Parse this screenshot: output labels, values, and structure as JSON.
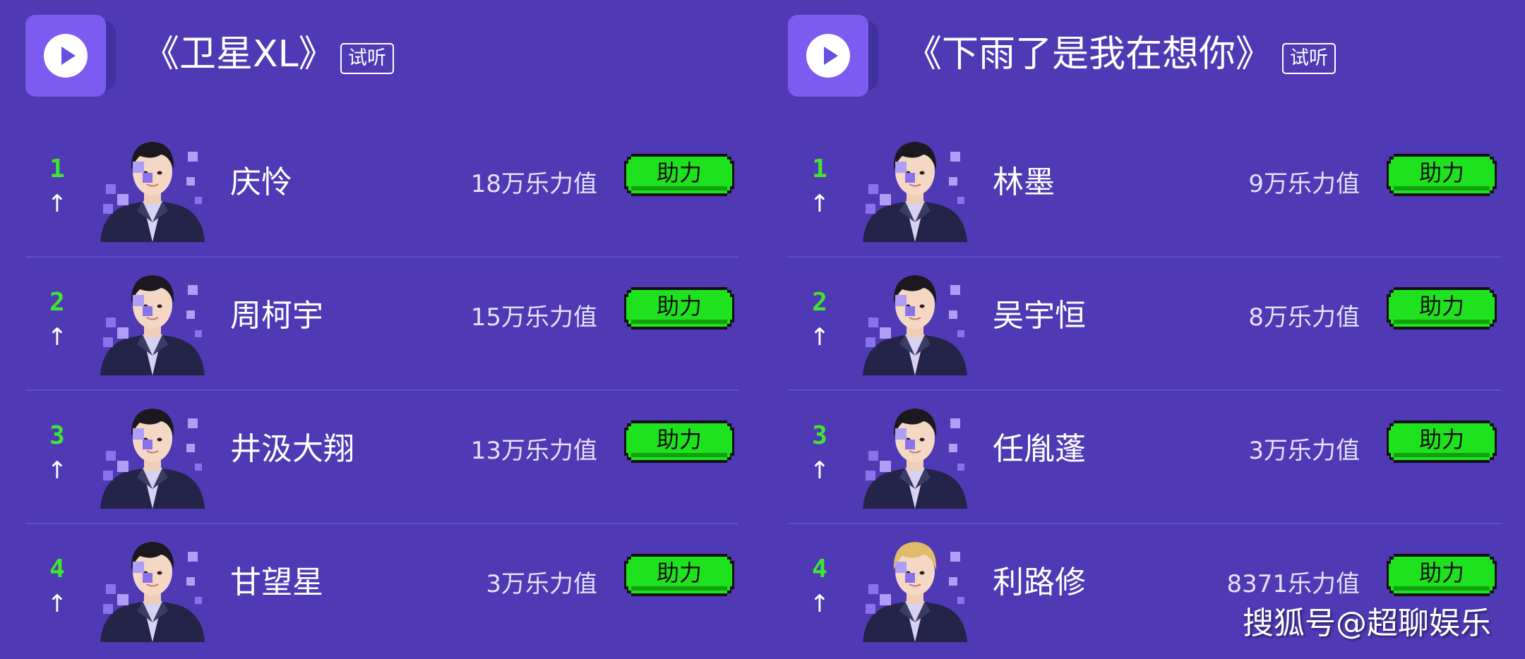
{
  "panels": [
    {
      "song_title": "《卫星XL》",
      "preview_label": "试听",
      "entries": [
        {
          "rank": "1",
          "trend": "↑",
          "name": "庆怜",
          "value": "18万乐力值",
          "boost_label": "助力"
        },
        {
          "rank": "2",
          "trend": "↑",
          "name": "周柯宇",
          "value": "15万乐力值",
          "boost_label": "助力"
        },
        {
          "rank": "3",
          "trend": "↑",
          "name": "井汲大翔",
          "value": "13万乐力值",
          "boost_label": "助力"
        },
        {
          "rank": "4",
          "trend": "↑",
          "name": "甘望星",
          "value": "3万乐力值",
          "boost_label": "助力"
        }
      ]
    },
    {
      "song_title": "《下雨了是我在想你》",
      "preview_label": "试听",
      "entries": [
        {
          "rank": "1",
          "trend": "↑",
          "name": "林墨",
          "value": "9万乐力值",
          "boost_label": "助力"
        },
        {
          "rank": "2",
          "trend": "↑",
          "name": "吴宇恒",
          "value": "8万乐力值",
          "boost_label": "助力"
        },
        {
          "rank": "3",
          "trend": "↑",
          "name": "任胤蓬",
          "value": "3万乐力值",
          "boost_label": "助力"
        },
        {
          "rank": "4",
          "trend": "↑",
          "name": "利路修",
          "value": "8371乐力值",
          "boost_label": "助力"
        }
      ]
    }
  ],
  "watermark": "搜狐号@超聊娱乐",
  "icons": {
    "play": "play-icon",
    "trend": "up-arrow-icon"
  },
  "colors": {
    "background": "#5039b4",
    "play_button": "#7c5cf0",
    "boost_button": "#1ee21e",
    "rank_text": "#3ee630",
    "hair_blonde": "#e0bb6a"
  }
}
